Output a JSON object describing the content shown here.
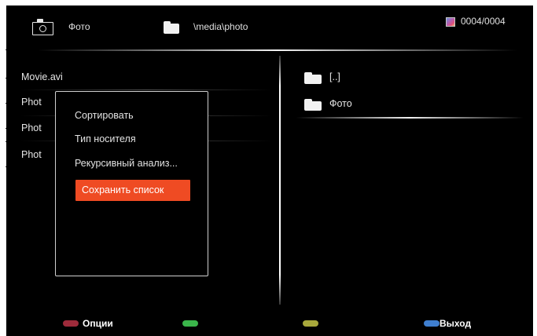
{
  "header": {
    "source_icon": "camera-icon",
    "source_label": "Фото",
    "path_icon": "folder-icon",
    "path": "\\media\\photo",
    "counter_icon": "photo-file-icon",
    "counter": "0004/0004"
  },
  "file_list": [
    "Movie.avi",
    "Phot",
    "Phot",
    "Phot"
  ],
  "folder_list": [
    {
      "icon": "folder-icon",
      "label": "[..]"
    },
    {
      "icon": "folder-icon",
      "label": "Фото"
    }
  ],
  "options_menu": {
    "items": [
      "Сортировать",
      "Тип носителя",
      "Рекурсивный анализ...",
      "Сохранить список"
    ],
    "selected_index": 3
  },
  "legend": {
    "red": {
      "label": "Опции",
      "color": "#9e2b3b"
    },
    "green": {
      "label": "",
      "color": "#3ab54a"
    },
    "yellow": {
      "label": "",
      "color": "#a8a83c"
    },
    "blue": {
      "label": "Выход",
      "color": "#3f7fd0"
    }
  },
  "colors": {
    "background": "#000000",
    "highlight": "#ef4b23",
    "text": "#e6e6e6"
  }
}
